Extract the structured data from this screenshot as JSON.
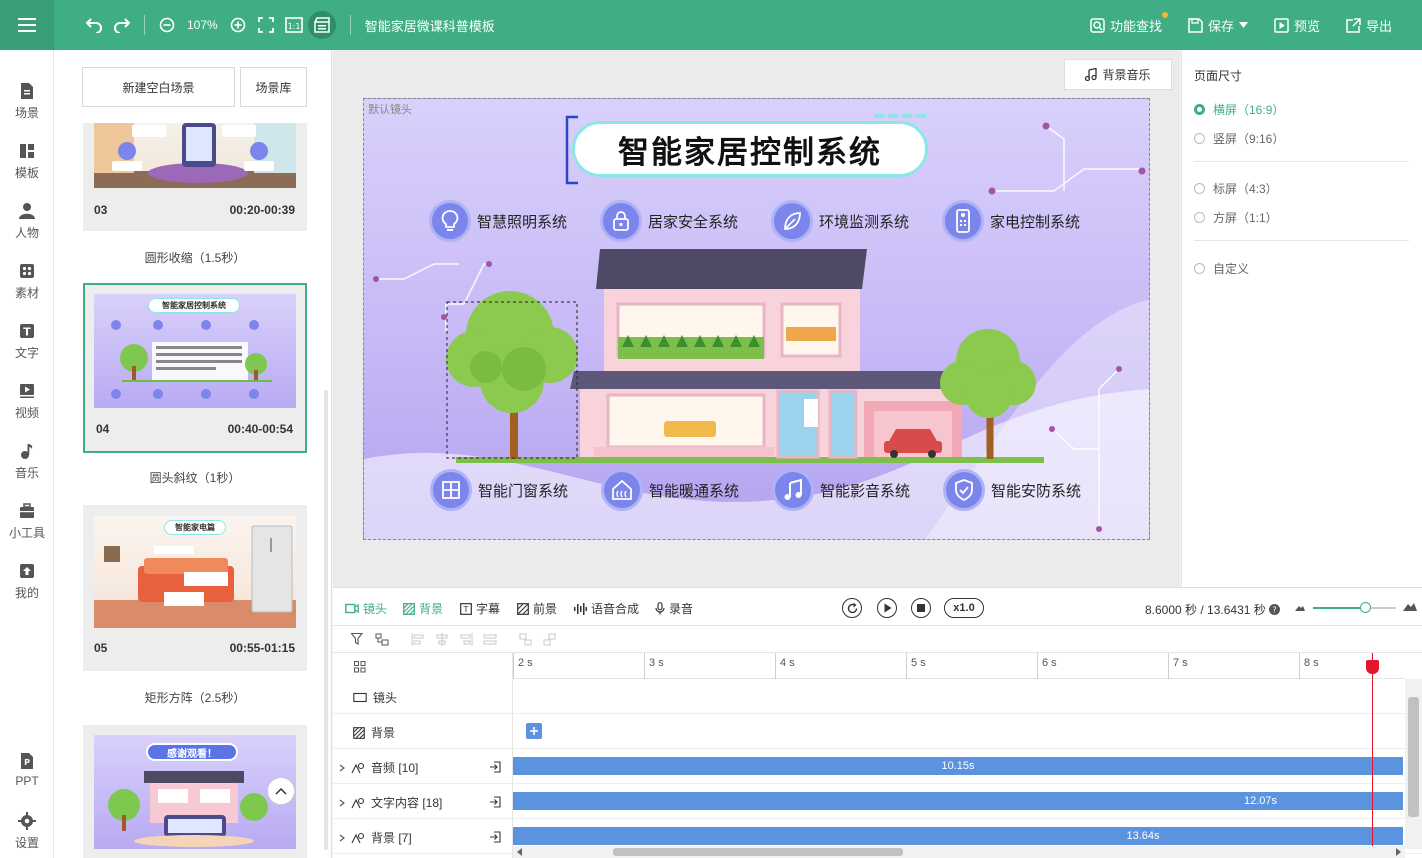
{
  "toolbar": {
    "zoom": "107%",
    "doc_title": "智能家居微课科普模板",
    "feature_search": "功能查找",
    "save": "保存",
    "preview": "预览",
    "export": "导出"
  },
  "leftnav": [
    {
      "label": "场景",
      "icon": "scene-icon"
    },
    {
      "label": "模板",
      "icon": "template-icon"
    },
    {
      "label": "人物",
      "icon": "person-icon"
    },
    {
      "label": "素材",
      "icon": "material-icon"
    },
    {
      "label": "文字",
      "icon": "text-icon"
    },
    {
      "label": "视频",
      "icon": "video-icon"
    },
    {
      "label": "音乐",
      "icon": "music-icon"
    },
    {
      "label": "小工具",
      "icon": "tools-icon"
    },
    {
      "label": "我的",
      "icon": "mine-icon"
    },
    {
      "label": "PPT",
      "icon": "ppt-icon"
    },
    {
      "label": "设置",
      "icon": "settings-icon"
    }
  ],
  "scene_panel": {
    "new_blank": "新建空白场景",
    "library": "场景库",
    "scenes": [
      {
        "num": "03",
        "time": "00:20-00:39",
        "transition": "圆形收缩（1.5秒）"
      },
      {
        "num": "04",
        "time": "00:40-00:54",
        "transition": "圆头斜纹（1秒）",
        "thumb_title": "智能家居控制系统"
      },
      {
        "num": "05",
        "time": "00:55-01:15",
        "transition": "矩形方阵（2.5秒）",
        "thumb_title": "智能家电篇"
      },
      {
        "thumb_title": "感谢观看！"
      }
    ]
  },
  "canvas": {
    "bgm": "背景音乐",
    "camera_label": "默认镜头",
    "title": "智能家居控制系统",
    "features_top": [
      "智慧照明系统",
      "居家安全系统",
      "环境监测系统",
      "家电控制系统"
    ],
    "features_bottom": [
      "智能门窗系统",
      "智能暖通系统",
      "智能影音系统",
      "智能安防系统"
    ]
  },
  "right_panel": {
    "title": "页面尺寸",
    "options": [
      {
        "label": "横屏（16:9）",
        "selected": true
      },
      {
        "label": "竖屏（9:16）",
        "selected": false
      },
      {
        "label": "标屏（4:3）",
        "selected": false
      },
      {
        "label": "方屏（1:1）",
        "selected": false
      },
      {
        "label": "自定义",
        "selected": false
      }
    ]
  },
  "timeline": {
    "tabs": [
      "镜头",
      "背景",
      "字幕",
      "前景",
      "语音合成",
      "录音"
    ],
    "speed": "x1.0",
    "time_readout": "8.6000 秒 / 13.6431 秒",
    "ruler": [
      "2 s",
      "3 s",
      "4 s",
      "5 s",
      "6 s",
      "7 s",
      "8 s"
    ],
    "tracks": [
      {
        "name": "镜头"
      },
      {
        "name": "背景"
      },
      {
        "name": "音频 [10]",
        "bar": "10.15s"
      },
      {
        "name": "文字内容 [18]",
        "bar": "12.07s"
      },
      {
        "name": "背景 [7]",
        "bar": "13.64s"
      }
    ]
  },
  "colors": {
    "accent": "#3fae84",
    "track": "#5b93de",
    "playhead": "#e3162c"
  }
}
